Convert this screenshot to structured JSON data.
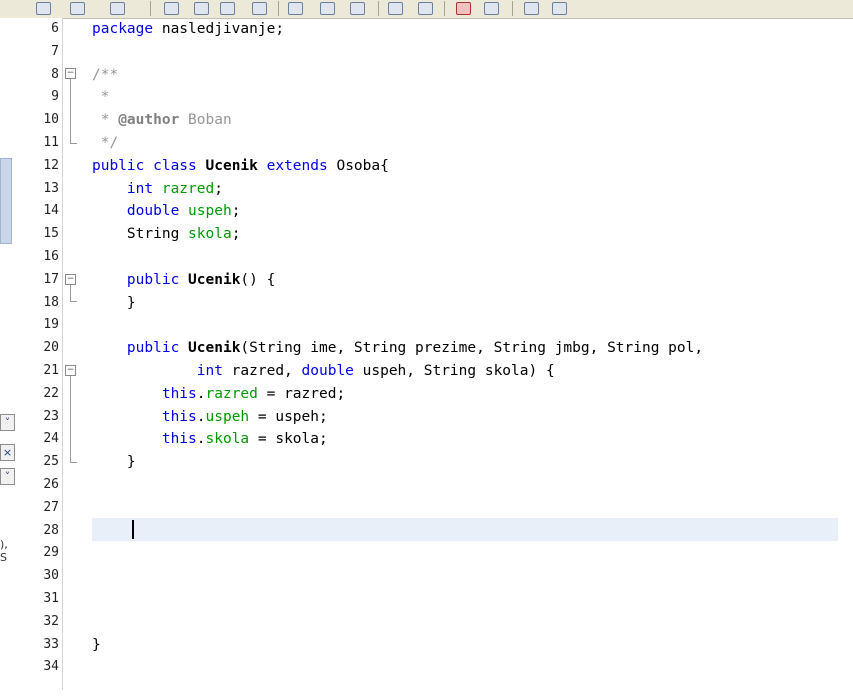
{
  "toolbar": {
    "icons": [
      "new-file-icon",
      "open-project-icon",
      "save-icon",
      "find-icon",
      "back-icon",
      "forward-icon",
      "toggle-icon",
      "previous-occurrence-icon",
      "next-occurrence-icon",
      "comment-icon",
      "record-macro-icon",
      "stop-icon",
      "run-icon",
      "debug-icon"
    ]
  },
  "left_panel": {
    "partial_text": "), S",
    "buttons": [
      "˅",
      "×",
      "˅"
    ]
  },
  "editor": {
    "line_numbers": [
      "6",
      "7",
      "8",
      "9",
      "10",
      "11",
      "12",
      "13",
      "14",
      "15",
      "16",
      "17",
      "18",
      "19",
      "20",
      "21",
      "22",
      "23",
      "24",
      "25",
      "26",
      "27",
      "28",
      "29",
      "30",
      "31",
      "32",
      "33",
      "34"
    ],
    "code": {
      "l6_kw": "package",
      "l6_rest": " nasledjivanje;",
      "l8": "/**",
      "l9": " *",
      "l10_star": " * ",
      "l10_tag": "@author",
      "l10_name": " Boban",
      "l11": " */",
      "l12_kw1": "public",
      "l12_kw2": " class",
      "l12_cls": " Ucenik",
      "l12_kw3": " extends",
      "l12_rest": " Osoba{",
      "l13_kw": "    int",
      "l13_fld": " razred",
      "l13_end": ";",
      "l14_kw": "    double",
      "l14_fld": " uspeh",
      "l14_end": ";",
      "l15_type": "    String",
      "l15_fld": " skola",
      "l15_end": ";",
      "l17_kw": "    public",
      "l17_name": " Ucenik",
      "l17_rest": "() {",
      "l18": "    }",
      "l20_kw": "    public",
      "l20_name": " Ucenik",
      "l20_rest": "(String ime, String prezime, String jmbg, String pol,",
      "l21_kw": "            int",
      "l21_mid": " razred,",
      "l21_kw2": " double",
      "l21_rest": " uspeh, String skola) {",
      "l22_kw": "        this",
      "l22_dot": ".",
      "l22_fld": "razred",
      "l22_rest": " = razred;",
      "l23_kw": "        this",
      "l23_dot": ".",
      "l23_fld": "uspeh",
      "l23_rest": " = uspeh;",
      "l24_kw": "        this",
      "l24_dot": ".",
      "l24_fld": "skola",
      "l24_rest": " = skola;",
      "l25": "    }",
      "l33": "}"
    },
    "current_line": "28"
  },
  "colors": {
    "keyword": "#0000e6",
    "field": "#009900",
    "comment": "#969696",
    "current_line_bg": "#e9eff8"
  }
}
